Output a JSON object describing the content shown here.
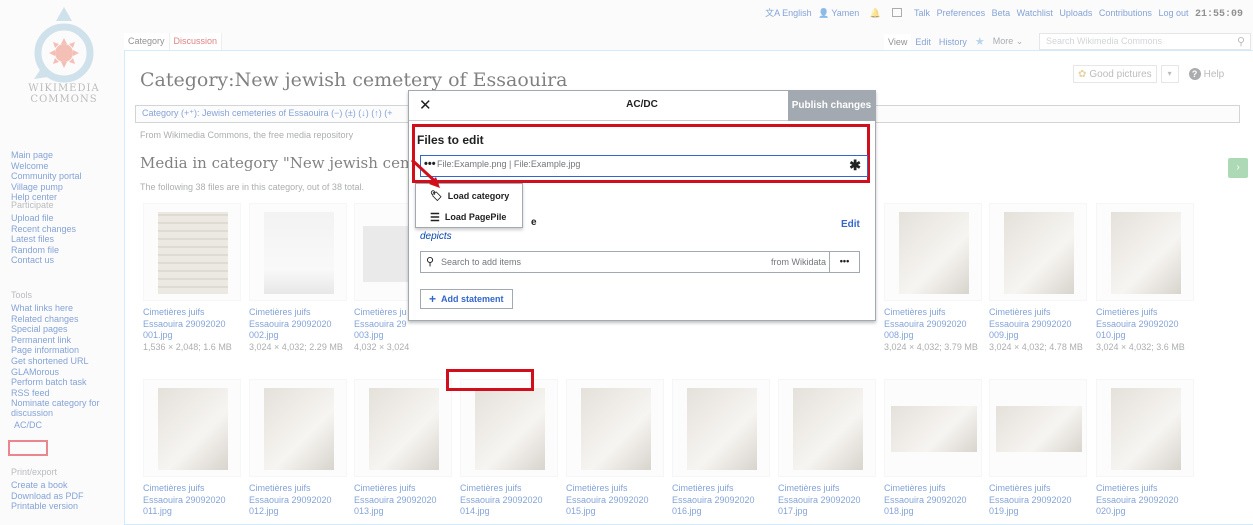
{
  "logo": {
    "wordmark1": "WIKIMEDIA",
    "wordmark2": "COMMONS"
  },
  "sidebar": {
    "nav": [
      "Main page",
      "Welcome",
      "Community portal",
      "Village pump",
      "Help center"
    ],
    "participate": {
      "heading": "Participate",
      "items": [
        "Upload file",
        "Recent changes",
        "Latest files",
        "Random file",
        "Contact us"
      ]
    },
    "tools": {
      "heading": "Tools",
      "items": [
        "What links here",
        "Related changes",
        "Special pages",
        "Permanent link",
        "Page information",
        "Get shortened URL",
        "GLAMorous",
        "Perform batch task",
        "RSS feed",
        "Nominate category for",
        "discussion",
        "AC/DC"
      ]
    },
    "print": {
      "heading": "Print/export",
      "items": [
        "Create a book",
        "Download as PDF",
        "Printable version"
      ]
    }
  },
  "personal": {
    "language": "English",
    "user": "Yamen",
    "links": [
      "Talk",
      "Preferences",
      "Beta",
      "Watchlist",
      "Uploads",
      "Contributions",
      "Log out"
    ],
    "clock": "21:55:09"
  },
  "tabs": {
    "left": [
      "Category",
      "Discussion"
    ],
    "right": [
      "View",
      "Edit",
      "History",
      "More"
    ]
  },
  "search": {
    "placeholder": "Search Wikimedia Commons"
  },
  "page": {
    "title": "Category:New jewish cemetery of Essaouira",
    "good_pictures": "Good pictures",
    "help": "Help",
    "catbar": "Category (+⁺): Jewish cemeteries of Essaouira (−) (±) (↓) (↑) (+",
    "from": "From Wikimedia Commons, the free media repository",
    "media_heading": "Media in category \"New jewish cemetery of",
    "media_desc": "The following 38 files are in this category, out of 38 total."
  },
  "gallery": [
    {
      "l1": "Cimetières juifs",
      "l2": "Essaouira 29092020",
      "l3": "001.jpg",
      "dim": "1,536 × 2,048; 1.6 MB"
    },
    {
      "l1": "Cimetières juifs",
      "l2": "Essaouira 29092020",
      "l3": "002.jpg",
      "dim": "3,024 × 4,032; 2.29 MB"
    },
    {
      "l1": "Cimetières ju",
      "l2": "Essaouira 29",
      "l3": "003.jpg",
      "dim": "4,032 × 3,024"
    },
    {
      "l1": "Cimetières juifs",
      "l2": "Essaouira 29092020",
      "l3": "008.jpg",
      "dim": "3,024 × 4,032; 3.79 MB"
    },
    {
      "l1": "Cimetières juifs",
      "l2": "Essaouira 29092020",
      "l3": "009.jpg",
      "dim": "3,024 × 4,032; 4.78 MB"
    },
    {
      "l1": "Cimetières juifs",
      "l2": "Essaouira 29092020",
      "l3": "010.jpg",
      "dim": "3,024 × 4,032; 3.6 MB"
    },
    {
      "l1": "Cimetières juifs",
      "l2": "Essaouira 29092020",
      "l3": "011.jpg"
    },
    {
      "l1": "Cimetières juifs",
      "l2": "Essaouira 29092020",
      "l3": "012.jpg"
    },
    {
      "l1": "Cimetières juifs",
      "l2": "Essaouira 29092020",
      "l3": "013.jpg"
    },
    {
      "l1": "Cimetières juifs",
      "l2": "Essaouira 29092020",
      "l3": "014.jpg"
    },
    {
      "l1": "Cimetières juifs",
      "l2": "Essaouira 29092020",
      "l3": "015.jpg"
    },
    {
      "l1": "Cimetières juifs",
      "l2": "Essaouira 29092020",
      "l3": "016.jpg"
    },
    {
      "l1": "Cimetières juifs",
      "l2": "Essaouira 29092020",
      "l3": "017.jpg"
    },
    {
      "l1": "Cimetières juifs",
      "l2": "Essaouira 29092020",
      "l3": "018.jpg"
    },
    {
      "l1": "Cimetières juifs",
      "l2": "Essaouira 29092020",
      "l3": "019.jpg"
    },
    {
      "l1": "Cimetières juifs",
      "l2": "Essaouira 29092020",
      "l3": "020.jpg"
    }
  ],
  "dialog": {
    "title": "AC/DC",
    "publish": "Publish changes",
    "files_label": "Files to edit",
    "files_placeholder": "File:Example.png | File:Example.jpg",
    "property_fragment": "e",
    "depicts": "depicts",
    "edit": "Edit",
    "search_placeholder": "Search to add items",
    "search_source": "from Wikidata",
    "add_statement": "Add statement"
  },
  "menu": {
    "load_category": "Load category",
    "load_pagepile": "Load PagePile"
  },
  "colors": {
    "link": "#0645ad",
    "highlight": "#d10f1c",
    "progressive": "#36c",
    "disabled": "#a2a9b1"
  }
}
